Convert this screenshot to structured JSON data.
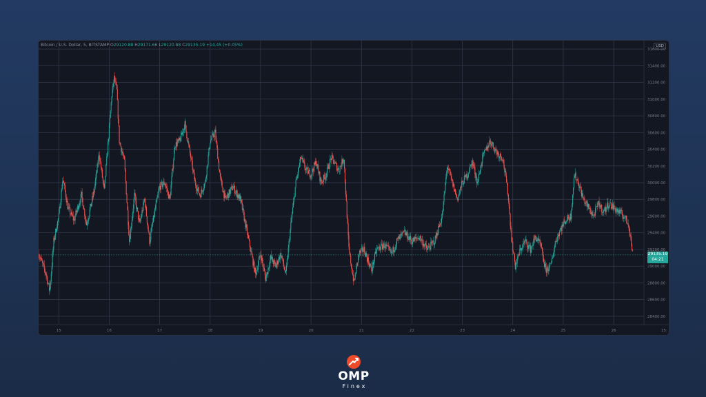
{
  "chart_data": {
    "type": "candlestick",
    "symbol_line": "Bitcoin / U.S. Dollar, 5, BITSTAMP",
    "ohlc": {
      "open_label": "O",
      "open": "29120.88",
      "high_label": "H",
      "high": "29171.66",
      "low_label": "L",
      "low": "29120.88",
      "close_label": "C",
      "close": "29135.19",
      "change": "+14.45 (+0.05%)"
    },
    "currency": "USD",
    "last_price": "29135.19",
    "countdown": "04:21",
    "x_ticks": [
      "15",
      "16",
      "17",
      "18",
      "19",
      "20",
      "21",
      "22",
      "23",
      "24",
      "25",
      "26",
      "15:"
    ],
    "y_ticks": [
      31600,
      31400,
      31200,
      31000,
      30800,
      30600,
      30400,
      30200,
      30000,
      29800,
      29600,
      29400,
      29200,
      29000,
      28800,
      28600,
      28400
    ],
    "y_tick_labels": [
      "31600.00",
      "31400.00",
      "31200.00",
      "31000.00",
      "30800.00",
      "30600.00",
      "30400.00",
      "30200.00",
      "30000.00",
      "29800.00",
      "29600.00",
      "29400.00",
      "29200.00",
      "29000.00",
      "28800.00",
      "28600.00",
      "28400.00"
    ],
    "ylim": [
      28300,
      31700
    ],
    "xlim": [
      14.6,
      26.6
    ],
    "path": [
      [
        14.6,
        29150
      ],
      [
        14.75,
        28900
      ],
      [
        14.82,
        28700
      ],
      [
        14.9,
        29300
      ],
      [
        15.0,
        29600
      ],
      [
        15.08,
        30050
      ],
      [
        15.18,
        29700
      ],
      [
        15.3,
        29550
      ],
      [
        15.45,
        29850
      ],
      [
        15.55,
        29500
      ],
      [
        15.7,
        29900
      ],
      [
        15.8,
        30350
      ],
      [
        15.9,
        29900
      ],
      [
        16.0,
        30650
      ],
      [
        16.05,
        31050
      ],
      [
        16.1,
        31250
      ],
      [
        16.15,
        31100
      ],
      [
        16.2,
        30500
      ],
      [
        16.3,
        30250
      ],
      [
        16.4,
        29300
      ],
      [
        16.5,
        29850
      ],
      [
        16.6,
        29500
      ],
      [
        16.7,
        29800
      ],
      [
        16.8,
        29300
      ],
      [
        16.9,
        29650
      ],
      [
        17.0,
        29950
      ],
      [
        17.1,
        30000
      ],
      [
        17.2,
        29800
      ],
      [
        17.3,
        30450
      ],
      [
        17.4,
        30500
      ],
      [
        17.5,
        30700
      ],
      [
        17.6,
        30350
      ],
      [
        17.7,
        30000
      ],
      [
        17.8,
        29850
      ],
      [
        17.9,
        30000
      ],
      [
        18.0,
        30500
      ],
      [
        18.1,
        30600
      ],
      [
        18.2,
        30050
      ],
      [
        18.3,
        29800
      ],
      [
        18.45,
        29950
      ],
      [
        18.6,
        29800
      ],
      [
        18.8,
        29200
      ],
      [
        18.9,
        28900
      ],
      [
        19.0,
        29150
      ],
      [
        19.1,
        28850
      ],
      [
        19.2,
        29100
      ],
      [
        19.3,
        29000
      ],
      [
        19.4,
        29150
      ],
      [
        19.5,
        28900
      ],
      [
        19.6,
        29500
      ],
      [
        19.7,
        30000
      ],
      [
        19.8,
        30300
      ],
      [
        19.9,
        30150
      ],
      [
        20.0,
        30100
      ],
      [
        20.1,
        30250
      ],
      [
        20.2,
        30000
      ],
      [
        20.3,
        30100
      ],
      [
        20.4,
        30300
      ],
      [
        20.55,
        30150
      ],
      [
        20.65,
        30300
      ],
      [
        20.75,
        29200
      ],
      [
        20.85,
        28800
      ],
      [
        20.95,
        29150
      ],
      [
        21.05,
        29200
      ],
      [
        21.2,
        28950
      ],
      [
        21.3,
        29200
      ],
      [
        21.45,
        29250
      ],
      [
        21.6,
        29150
      ],
      [
        21.7,
        29300
      ],
      [
        21.85,
        29400
      ],
      [
        22.0,
        29300
      ],
      [
        22.15,
        29350
      ],
      [
        22.3,
        29200
      ],
      [
        22.45,
        29300
      ],
      [
        22.6,
        29600
      ],
      [
        22.7,
        30200
      ],
      [
        22.8,
        30000
      ],
      [
        22.9,
        29800
      ],
      [
        23.0,
        30000
      ],
      [
        23.1,
        30100
      ],
      [
        23.2,
        30250
      ],
      [
        23.3,
        30000
      ],
      [
        23.4,
        30300
      ],
      [
        23.55,
        30500
      ],
      [
        23.7,
        30350
      ],
      [
        23.8,
        30300
      ],
      [
        23.9,
        29900
      ],
      [
        23.98,
        29300
      ],
      [
        24.05,
        29000
      ],
      [
        24.15,
        29200
      ],
      [
        24.25,
        29300
      ],
      [
        24.35,
        29200
      ],
      [
        24.45,
        29350
      ],
      [
        24.55,
        29250
      ],
      [
        24.65,
        28950
      ],
      [
        24.75,
        29000
      ],
      [
        24.85,
        29300
      ],
      [
        24.95,
        29450
      ],
      [
        25.05,
        29550
      ],
      [
        25.15,
        29600
      ],
      [
        25.22,
        30100
      ],
      [
        25.3,
        30000
      ],
      [
        25.4,
        29800
      ],
      [
        25.5,
        29700
      ],
      [
        25.6,
        29600
      ],
      [
        25.7,
        29750
      ],
      [
        25.8,
        29650
      ],
      [
        25.9,
        29750
      ],
      [
        26.0,
        29700
      ],
      [
        26.1,
        29650
      ],
      [
        26.2,
        29600
      ],
      [
        26.3,
        29500
      ],
      [
        26.38,
        29135
      ]
    ]
  },
  "brand": {
    "name": "OMP",
    "sub": "Finex"
  },
  "colors": {
    "up": "#26a69a",
    "down": "#ef5350",
    "background": "#131722",
    "grid": "#363c4e",
    "axis_text": "#787b86",
    "brand_accent": "#ee4b2b"
  }
}
